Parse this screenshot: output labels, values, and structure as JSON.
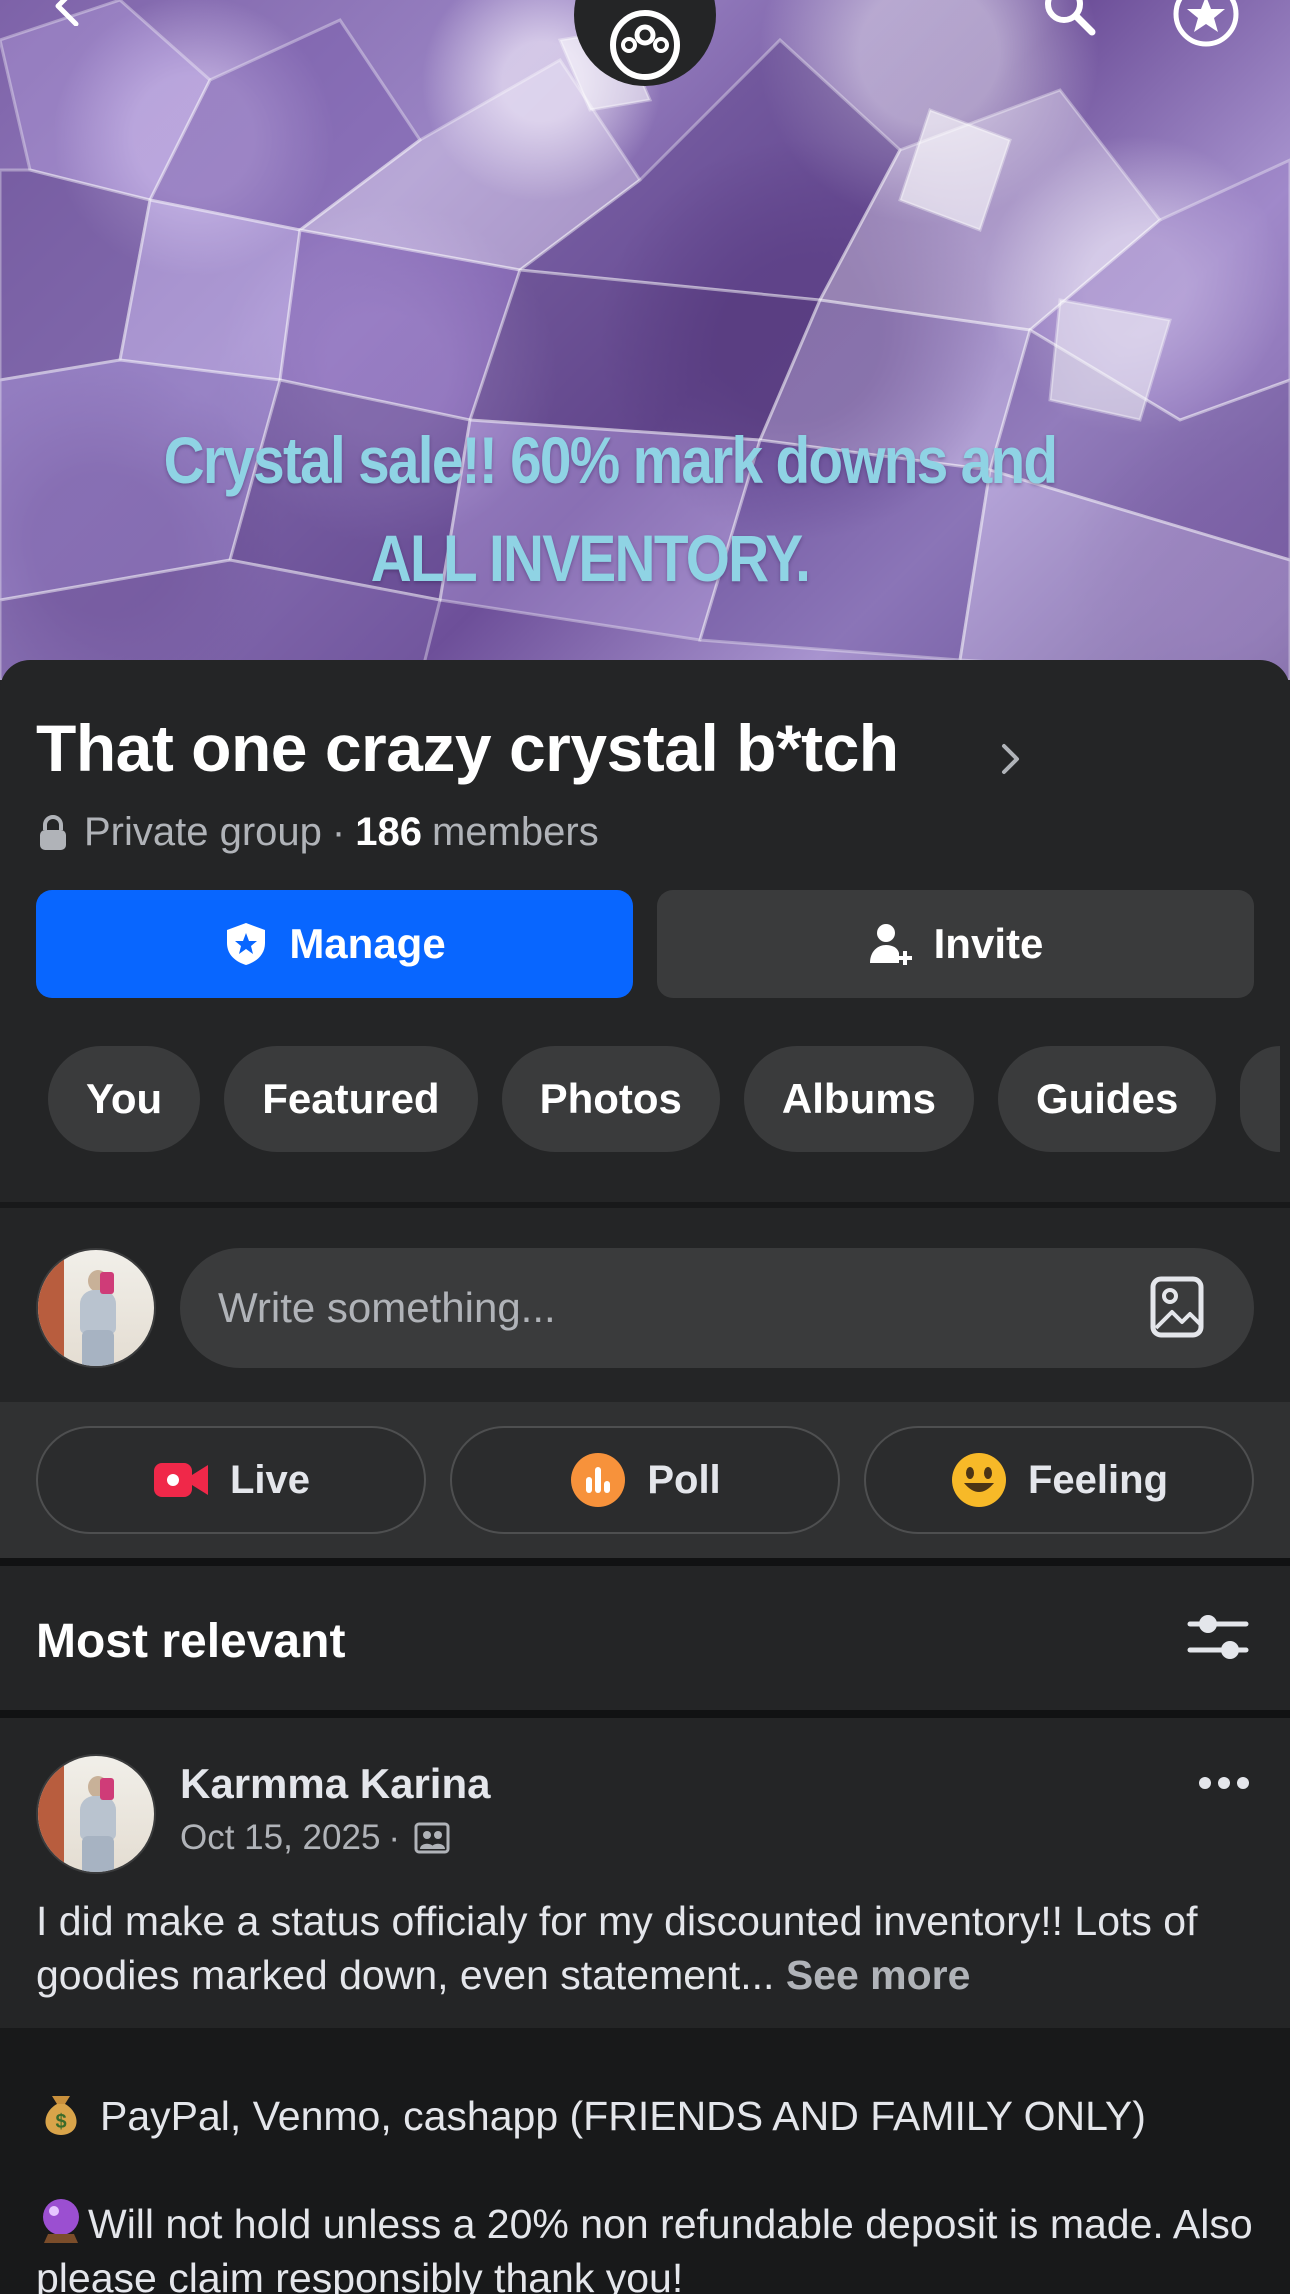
{
  "cover": {
    "line1": "Crystal sale!! 60% mark downs and",
    "line2": "ALL INVENTORY."
  },
  "group": {
    "name": "That one crazy crystal b*tch",
    "privacy": "Private group",
    "separator": "·",
    "member_count": "186",
    "members_label": "members"
  },
  "buttons": {
    "manage": "Manage",
    "invite": "Invite"
  },
  "tabs": [
    "You",
    "Featured",
    "Photos",
    "Albums",
    "Guides"
  ],
  "composer": {
    "placeholder": "Write something..."
  },
  "actions": {
    "live": "Live",
    "poll": "Poll",
    "feeling": "Feeling"
  },
  "feed": {
    "sort_label": "Most relevant"
  },
  "post": {
    "author": "Karmma Karina",
    "date": "Oct 15, 2025",
    "dot": "·",
    "body": "I did make a status officialy for my discounted inventory!! Lots of goodies marked down, even statement...",
    "see_more": "See more"
  },
  "status": {
    "line1": "PayPal, Venmo, cashapp (FRIENDS AND FAMILY ONLY)",
    "line2": "Will not hold unless a 20% non refundable deposit is made. Also please claim responsibly thank you!"
  },
  "icons": {
    "back": "chevron-left-icon",
    "group_badge": "group-members-icon",
    "search": "search-icon",
    "star": "star-badge-icon",
    "lock": "lock-icon",
    "shield": "shield-star-icon",
    "add_person": "add-person-icon",
    "photo": "photo-icon",
    "live": "video-camera-icon",
    "poll": "poll-chart-icon",
    "feeling": "smiley-icon",
    "filter": "filter-sliders-icon",
    "more": "more-dots-icon",
    "audience": "group-audience-icon",
    "money": "money-bag-icon",
    "crystal_ball": "crystal-ball-icon"
  },
  "colors": {
    "accent": "#0866ff",
    "cover_text": "#8fd3e4",
    "background": "#242526",
    "live_red": "#f02849",
    "poll_orange": "#f7923b",
    "feeling_yellow": "#f7b928"
  }
}
